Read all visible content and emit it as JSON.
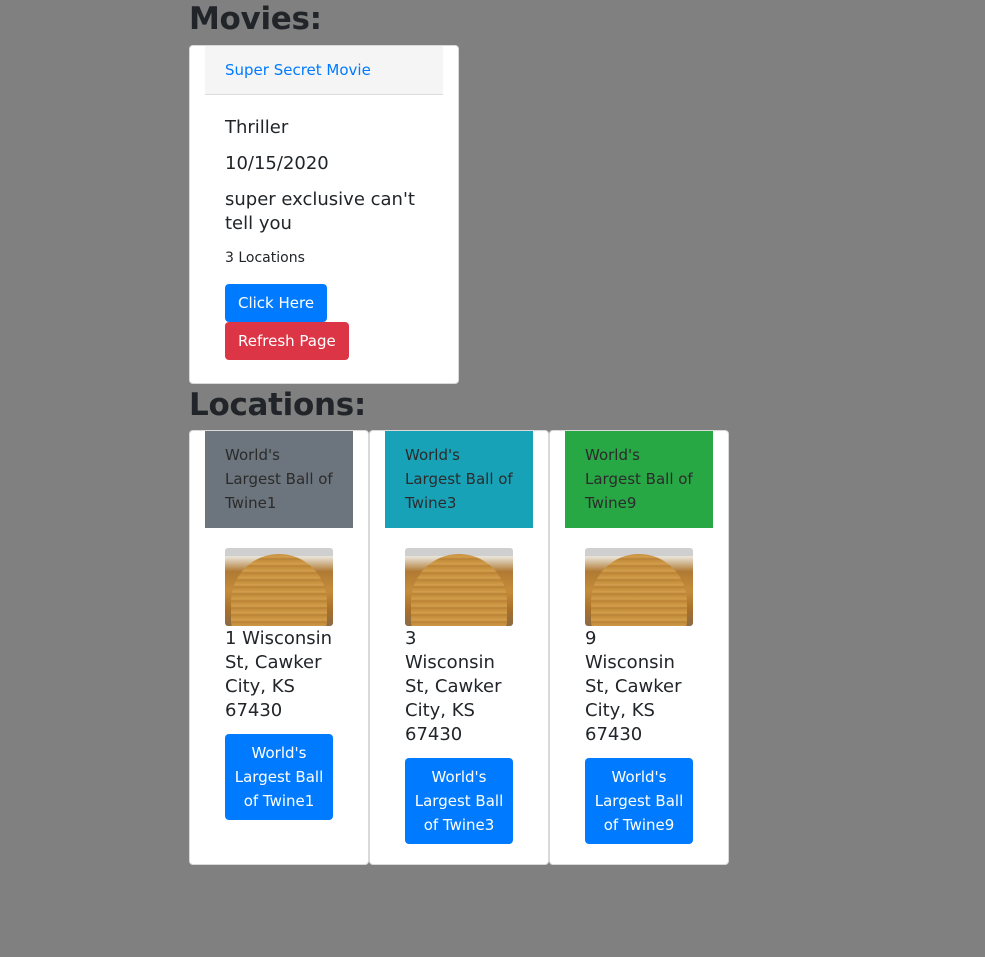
{
  "sections": {
    "movies_heading": "Movies:",
    "locations_heading": "Locations:"
  },
  "movie": {
    "title_link": "Super Secret Movie",
    "genre": "Thriller",
    "date": "10/15/2020",
    "description": "super exclusive can't tell you",
    "locations_count": "3 Locations",
    "click_button": "Click Here",
    "refresh_button": "Refresh Page"
  },
  "locations": [
    {
      "header": "World's Largest Ball of Twine1",
      "header_color": "#6c757d",
      "image": "ball-of-twine-photo",
      "address": "1 Wisconsin St, Cawker City, KS 67430",
      "button": "World's Largest Ball of Twine1"
    },
    {
      "header": "World's Largest Ball of Twine3",
      "header_color": "#17a2b8",
      "image": "ball-of-twine-photo",
      "address": "3 Wisconsin St, Cawker City, KS 67430",
      "button": "World's Largest Ball of Twine3"
    },
    {
      "header": "World's Largest Ball of Twine9",
      "header_color": "#28a745",
      "image": "ball-of-twine-photo",
      "address": "9 Wisconsin St, Cawker City, KS 67430",
      "button": "World's Largest Ball of Twine9"
    }
  ],
  "colors": {
    "background": "#808080",
    "primary": "#007bff",
    "danger": "#dc3545"
  }
}
